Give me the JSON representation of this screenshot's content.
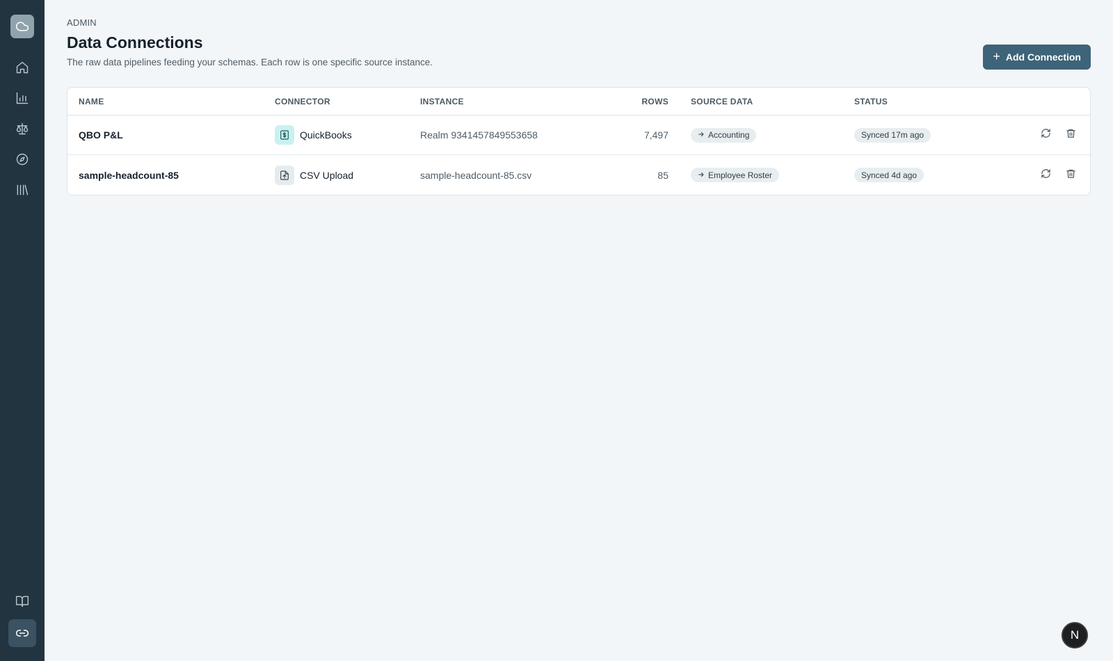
{
  "sidebar": {
    "logo_icon": "cloud-icon",
    "nav": [
      {
        "icon": "home-icon"
      },
      {
        "icon": "bar-chart-icon"
      },
      {
        "icon": "scale-icon"
      },
      {
        "icon": "compass-icon"
      },
      {
        "icon": "library-icon"
      }
    ],
    "bottom": [
      {
        "icon": "book-open-icon"
      },
      {
        "icon": "link-icon",
        "active": true
      }
    ]
  },
  "header": {
    "eyebrow": "ADMIN",
    "title": "Data Connections",
    "subtitle": "The raw data pipelines feeding your schemas. Each row is one specific source instance.",
    "add_button_label": "Add Connection"
  },
  "table": {
    "columns": [
      "NAME",
      "CONNECTOR",
      "INSTANCE",
      "ROWS",
      "SOURCE DATA",
      "STATUS"
    ],
    "rows": [
      {
        "name": "QBO P&L",
        "connector": "QuickBooks",
        "connector_icon": "dollar-document-icon",
        "instance": "Realm 9341457849553658",
        "rows": "7,497",
        "source_data": "Accounting",
        "status": "Synced 17m ago"
      },
      {
        "name": "sample-headcount-85",
        "connector": "CSV Upload",
        "connector_icon": "file-upload-icon",
        "instance": "sample-headcount-85.csv",
        "rows": "85",
        "source_data": "Employee Roster",
        "status": "Synced 4d ago"
      }
    ]
  },
  "avatar": {
    "initial": "N"
  },
  "colors": {
    "sidebar_bg": "#223440",
    "primary": "#3d6478",
    "page_bg": "#f3f6f8",
    "quickbooks_tint": "#c9f1f0"
  }
}
